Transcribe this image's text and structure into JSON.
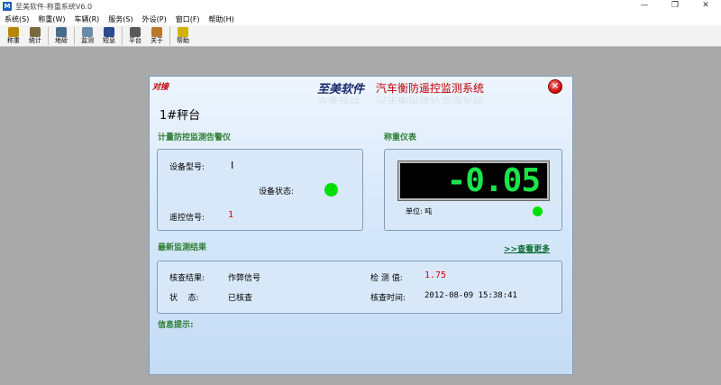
{
  "window": {
    "title": "至美软件-称重系统V6.0",
    "controls": [
      "—",
      "❐",
      "✕"
    ]
  },
  "menu": [
    "系统(S)",
    "称重(W)",
    "车辆(R)",
    "服务(S)",
    "外设(P)",
    "窗口(F)",
    "帮助(H)"
  ],
  "toolbar": [
    {
      "label": "称重",
      "icon": "truck-weigh-icon",
      "color": "#b8860b"
    },
    {
      "label": "统计",
      "icon": "stats-icon",
      "color": "#7a6a3a"
    },
    {
      "label": "地磅",
      "icon": "scale-icon",
      "color": "#4a6a8a"
    },
    {
      "label": "监测",
      "icon": "monitor-icon",
      "color": "#6a8aa8"
    },
    {
      "label": "短息",
      "icon": "sms-icon",
      "color": "#2a4a8a"
    },
    {
      "label": "平台",
      "icon": "platform-icon",
      "color": "#5a5a5a"
    },
    {
      "label": "关于",
      "icon": "about-icon",
      "color": "#b87a2a"
    },
    {
      "label": "帮助",
      "icon": "help-icon",
      "color": "#d4b000"
    }
  ],
  "panel": {
    "corner_label": "对接",
    "brand": "至美软件",
    "system_title": "汽车衡防遥控监测系统",
    "scale_name": "1#秤台",
    "alarm": {
      "section_title": "计量防控监测告警仪",
      "model_label": "设备型号:",
      "model_value": "I",
      "status_label": "设备状态:",
      "status_color": "#00e000",
      "signal_label": "遥控信号:",
      "signal_value": "1"
    },
    "meter": {
      "section_title": "称重仪表",
      "reading": "-0.05",
      "unit": "单位: 吨",
      "indicator_color": "#00e000"
    },
    "results": {
      "section_title": "最新监测结果",
      "more_link": ">>查看更多",
      "check_result_label": "核查结果:",
      "check_result_value": "作弊信号",
      "detect_value_label": "检 测 值:",
      "detect_value": "1.75",
      "state_label": "状    态:",
      "state_value": "已核查",
      "check_time_label": "核查时间:",
      "check_time_value": "2012-08-09 15:38:41"
    },
    "info_label": "信息提示:"
  }
}
